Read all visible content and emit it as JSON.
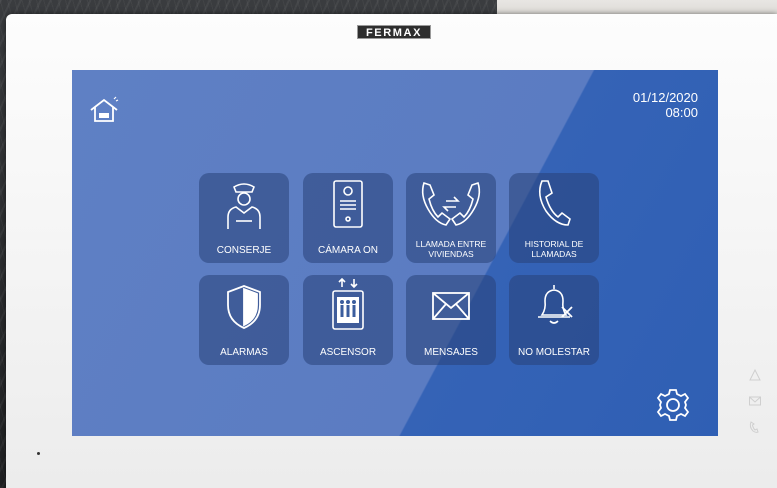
{
  "brand": "FERMAX",
  "datetime": {
    "date": "01/12/2020",
    "time": "08:00"
  },
  "tiles": [
    {
      "label": "CONSERJE",
      "icon": "concierge-icon"
    },
    {
      "label": "CÁMARA ON",
      "icon": "door-panel-camera-icon"
    },
    {
      "label": "LLAMADA ENTRE VIVIENDAS",
      "icon": "intercom-call-icon"
    },
    {
      "label": "HISTORIAL DE LLAMADAS",
      "icon": "phone-history-icon"
    },
    {
      "label": "ALARMAS",
      "icon": "shield-icon"
    },
    {
      "label": "ASCENSOR",
      "icon": "elevator-icon"
    },
    {
      "label": "MENSAJES",
      "icon": "envelope-icon"
    },
    {
      "label": "NO MOLESTAR",
      "icon": "bell-muted-icon"
    }
  ],
  "colors": {
    "screen_light": "#5f80c4",
    "screen_dark": "#2f5fb4",
    "tile": "#2a4a8a",
    "bezel": "#f6f6f6"
  }
}
